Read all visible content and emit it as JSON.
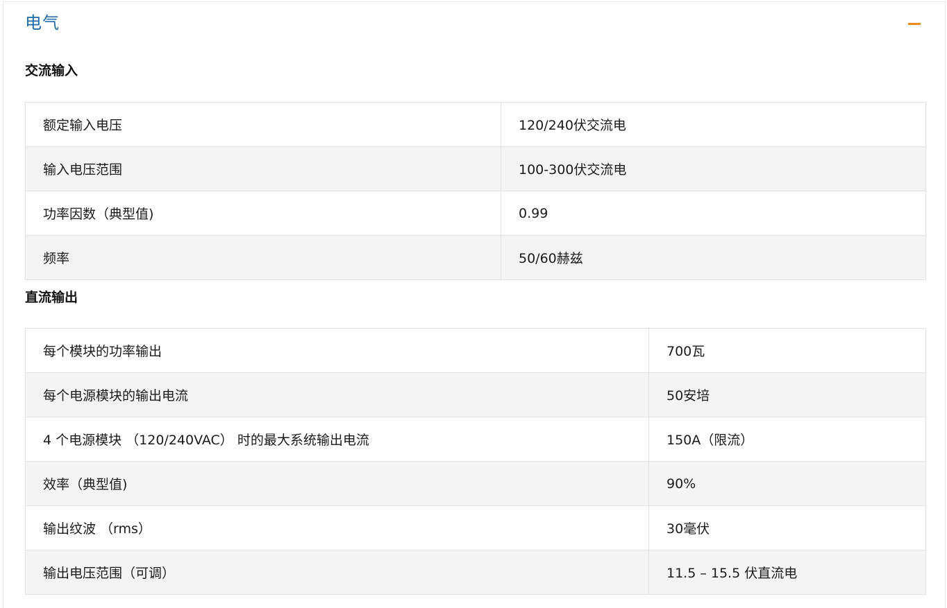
{
  "section": {
    "title": "电气",
    "collapse_icon": "minus-icon",
    "accent_color": "#f08a24",
    "title_color": "#1e6aa6"
  },
  "ac_input": {
    "heading": "交流输入",
    "rows": [
      {
        "label": "额定输入电压",
        "value": "120/240伏交流电"
      },
      {
        "label": "输入电压范围",
        "value": "100-300伏交流电"
      },
      {
        "label": "功率因数（典型值)",
        "value": "0.99"
      },
      {
        "label": "频率",
        "value": "50/60赫兹"
      }
    ]
  },
  "dc_output": {
    "heading": "直流输出",
    "rows": [
      {
        "label": "每个模块的功率输出",
        "value": "700瓦"
      },
      {
        "label": "每个电源模块的输出电流",
        "value": "50安培"
      },
      {
        "label": "4 个电源模块 （120/240VAC） 时的最大系统输出电流",
        "value": "150A（限流）"
      },
      {
        "label": "效率（典型值)",
        "value": "90%"
      },
      {
        "label": "输出纹波 （rms）",
        "value": "30毫伏"
      },
      {
        "label": "输出电压范围（可调）",
        "value": "11.5 – 15.5 伏直流电"
      }
    ]
  }
}
